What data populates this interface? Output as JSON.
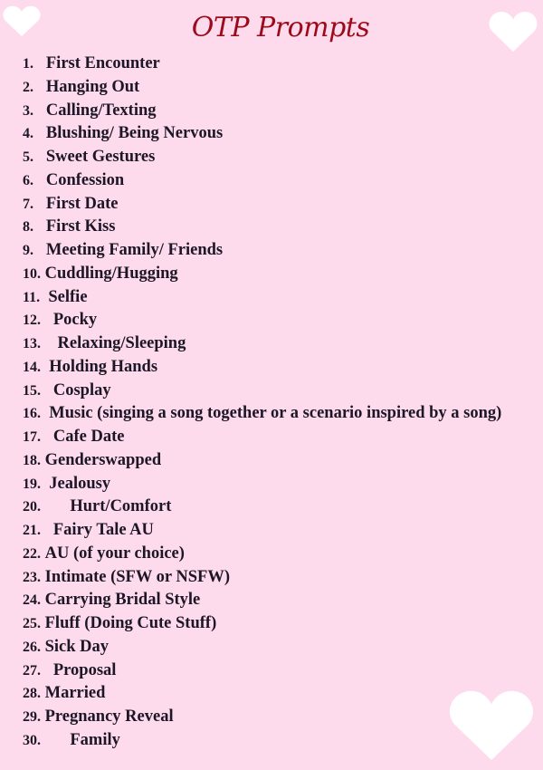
{
  "title": "OTP Prompts",
  "colors": {
    "background": "#fddbec",
    "title": "#9b0a1a",
    "text": "#1c1626",
    "hearts": "#ffffff"
  },
  "decorations": [
    {
      "icon": "heart-icon",
      "position": "top-left"
    },
    {
      "icon": "heart-icon",
      "position": "top-right"
    },
    {
      "icon": "heart-icon",
      "position": "bottom-right"
    }
  ],
  "prompts": [
    {
      "number": "1.",
      "sep": "  ",
      "text": "First Encounter"
    },
    {
      "number": "2.",
      "sep": "  ",
      "text": "Hanging Out"
    },
    {
      "number": "3.",
      "sep": "  ",
      "text": "Calling/Texting"
    },
    {
      "number": "4.",
      "sep": "  ",
      "text": "Blushing/ Being Nervous"
    },
    {
      "number": "5.",
      "sep": "  ",
      "text": "Sweet Gestures"
    },
    {
      "number": "6.",
      "sep": "  ",
      "text": "Confession"
    },
    {
      "number": "7.",
      "sep": "  ",
      "text": "First Date"
    },
    {
      "number": "8.",
      "sep": "  ",
      "text": "First Kiss"
    },
    {
      "number": "9.",
      "sep": "  ",
      "text": "Meeting Family/ Friends"
    },
    {
      "number": "10.",
      "sep": "",
      "text": "Cuddling/Hugging"
    },
    {
      "number": "11.",
      "sep": " ",
      "text": "Selfie"
    },
    {
      "number": "12.",
      "sep": "  ",
      "text": "Pocky"
    },
    {
      "number": "13.",
      "sep": "   ",
      "text": "Relaxing/Sleeping"
    },
    {
      "number": "14.",
      "sep": " ",
      "text": "Holding Hands"
    },
    {
      "number": "15.",
      "sep": "  ",
      "text": "Cosplay"
    },
    {
      "number": "16.",
      "sep": " ",
      "text": "Music (singing a song together or a scenario inspired by a song)"
    },
    {
      "number": "17.",
      "sep": "  ",
      "text": "Cafe Date"
    },
    {
      "number": "18.",
      "sep": "",
      "text": "Genderswapped"
    },
    {
      "number": "19.",
      "sep": " ",
      "text": "Jealousy"
    },
    {
      "number": "20.",
      "sep": "      ",
      "text": "Hurt/Comfort"
    },
    {
      "number": "21.",
      "sep": "  ",
      "text": "Fairy Tale AU"
    },
    {
      "number": "22.",
      "sep": "",
      "text": "AU (of your choice)"
    },
    {
      "number": "23.",
      "sep": "",
      "text": "Intimate (SFW or NSFW)"
    },
    {
      "number": "24.",
      "sep": "",
      "text": "Carrying Bridal Style"
    },
    {
      "number": "25.",
      "sep": "",
      "text": "Fluff (Doing Cute Stuff)"
    },
    {
      "number": "26.",
      "sep": "",
      "text": "Sick Day"
    },
    {
      "number": "27.",
      "sep": "  ",
      "text": "Proposal"
    },
    {
      "number": "28.",
      "sep": "",
      "text": "Married"
    },
    {
      "number": "29.",
      "sep": "",
      "text": "Pregnancy Reveal"
    },
    {
      "number": "30.",
      "sep": "      ",
      "text": "Family"
    }
  ]
}
